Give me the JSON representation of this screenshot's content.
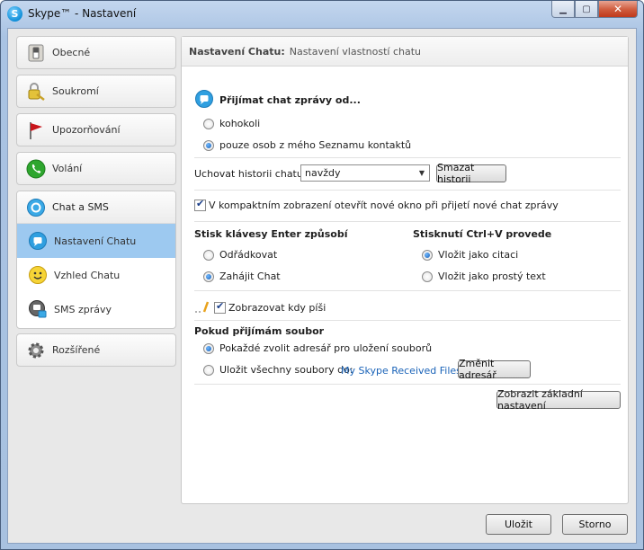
{
  "window": {
    "title": "Skype™ - Nastavení",
    "app_icon_letter": "S"
  },
  "sidebar": {
    "items": [
      {
        "label": "Obecné",
        "icon": "switch-icon"
      },
      {
        "label": "Soukromí",
        "icon": "lock-key-icon"
      },
      {
        "label": "Upozorňování",
        "icon": "red-flag-icon"
      },
      {
        "label": "Volání",
        "icon": "phone-icon"
      }
    ],
    "group": {
      "label": "Chat a SMS",
      "icon": "chat-icon",
      "subitems": [
        {
          "label": "Nastavení Chatu",
          "icon": "chat-bubble-icon",
          "active": true
        },
        {
          "label": "Vzhled Chatu",
          "icon": "smiley-icon"
        },
        {
          "label": "SMS zprávy",
          "icon": "sms-lock-icon"
        }
      ]
    },
    "advanced": {
      "label": "Rozšířené",
      "icon": "gear-icon"
    }
  },
  "panel": {
    "title_bold": "Nastavení Chatu:",
    "title_desc": "Nastavení vlastností chatu",
    "accept_heading": "Přijímat chat zprávy od...",
    "accept_options": [
      {
        "label": "kohokoli",
        "selected": false
      },
      {
        "label": "pouze osob z mého Seznamu kontaktů",
        "selected": true
      }
    ],
    "history_label": "Uchovat historii chatu",
    "history_value": "navždy",
    "clear_history_btn": "Smazat historii",
    "compact_checkbox": "V kompaktním zobrazení otevřít nové okno při přijetí nové chat zprávy",
    "compact_checked": true,
    "enter_heading": "Stisk klávesy Enter způsobí",
    "enter_options": [
      {
        "label": "Odřádkovat",
        "selected": false
      },
      {
        "label": "Zahájit Chat",
        "selected": true
      }
    ],
    "paste_heading": "Stisknutí Ctrl+V provede",
    "paste_options": [
      {
        "label": "Vložit jako citaci",
        "selected": true
      },
      {
        "label": "Vložit jako prostý text",
        "selected": false
      }
    ],
    "typing_checkbox": "Zobrazovat kdy píši",
    "typing_checked": true,
    "file_heading": "Pokud přijímám soubor",
    "file_options": [
      {
        "label": "Pokaždé zvolit adresář pro uložení souborů",
        "selected": true
      },
      {
        "label": "Uložit všechny soubory do:",
        "selected": false
      }
    ],
    "file_folder_link": "My Skype Received Files",
    "change_folder_btn": "Změnit adresář",
    "basic_settings_btn": "Zobrazit základní nastavení"
  },
  "footer": {
    "save_btn": "Uložit",
    "cancel_btn": "Storno"
  }
}
